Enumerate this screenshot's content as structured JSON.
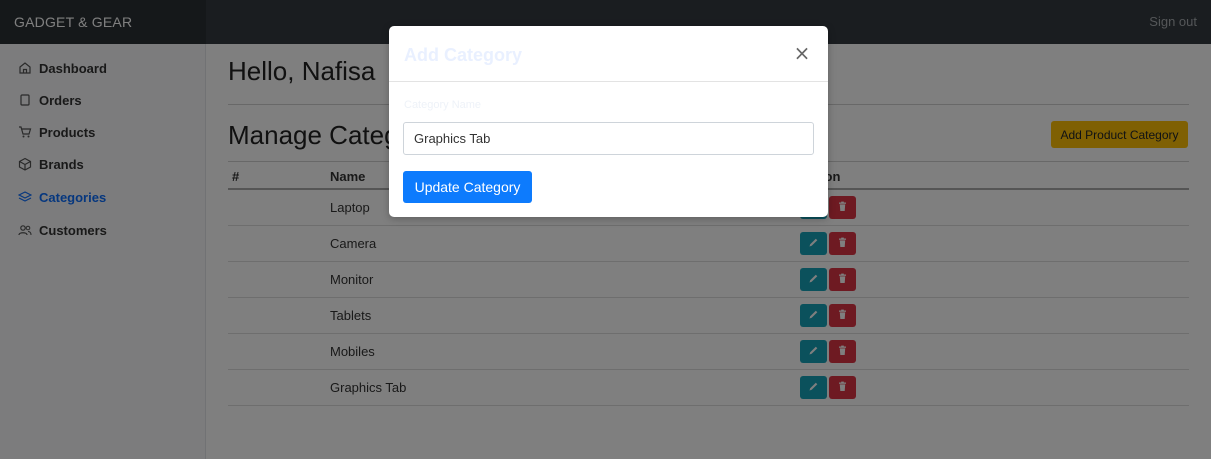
{
  "header": {
    "brand": "GADGET & GEAR",
    "signout_label": "Sign out"
  },
  "sidebar": {
    "items": [
      {
        "label": "Dashboard",
        "icon": "home-icon"
      },
      {
        "label": "Orders",
        "icon": "file-icon"
      },
      {
        "label": "Products",
        "icon": "cart-icon"
      },
      {
        "label": "Brands",
        "icon": "box-icon"
      },
      {
        "label": "Categories",
        "icon": "layers-icon",
        "active": true
      },
      {
        "label": "Customers",
        "icon": "users-icon"
      }
    ]
  },
  "main": {
    "greeting": "Hello, Nafisa",
    "section_title": "Manage Categories",
    "add_button_label": "Add Product Category",
    "table": {
      "headers": [
        "#",
        "Name",
        "Action"
      ],
      "rows": [
        {
          "name": "Laptop"
        },
        {
          "name": "Camera"
        },
        {
          "name": "Monitor"
        },
        {
          "name": "Tablets"
        },
        {
          "name": "Mobiles"
        },
        {
          "name": "Graphics Tab"
        }
      ]
    }
  },
  "modal": {
    "title": "Add Category",
    "close_label": "×",
    "field_label": "Category Name",
    "field_value": "Graphics Tab",
    "submit_label": "Update Category"
  },
  "colors": {
    "accent": "#0d6efd",
    "warning": "#ffc107",
    "edit": "#17a2b8",
    "delete": "#dc3545",
    "topbar": "#343a40"
  }
}
